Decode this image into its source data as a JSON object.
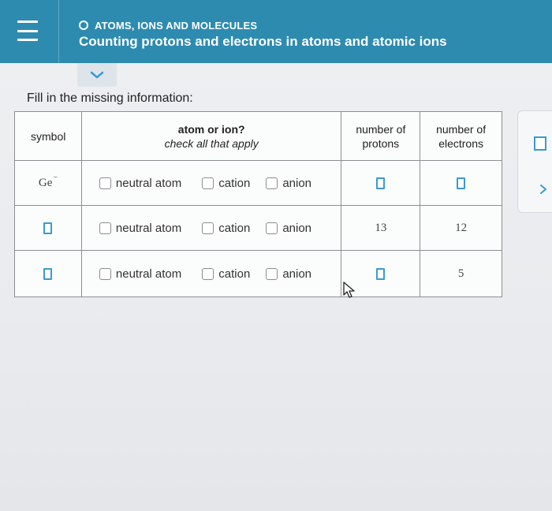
{
  "header": {
    "topic": "ATOMS, IONS AND MOLECULES",
    "title": "Counting protons and electrons in atoms and atomic ions",
    "menu_icon": "hamburger-menu-icon",
    "topic_icon": "circle-icon",
    "bg_color": "#2d8bb0"
  },
  "collapse": {
    "icon": "chevron-down-icon"
  },
  "instruction": "Fill in the missing information:",
  "table": {
    "headers": {
      "symbol": "symbol",
      "atom_or_ion": "atom or ion?",
      "check_all": "check all that apply",
      "protons_line1": "number of",
      "protons_line2": "protons",
      "electrons_line1": "number of",
      "electrons_line2": "electrons"
    },
    "options": {
      "neutral": "neutral atom",
      "cation": "cation",
      "anion": "anion"
    },
    "rows": [
      {
        "symbol": "Ge",
        "charge": "−",
        "protons": "",
        "electrons": ""
      },
      {
        "symbol": "",
        "charge": "",
        "protons": "13",
        "electrons": "12"
      },
      {
        "symbol": "",
        "charge": "",
        "protons": "",
        "electrons": "5"
      }
    ]
  },
  "side_panel": {
    "icon": "chevron-right-icon"
  },
  "accent_color": "#3c9ad0"
}
